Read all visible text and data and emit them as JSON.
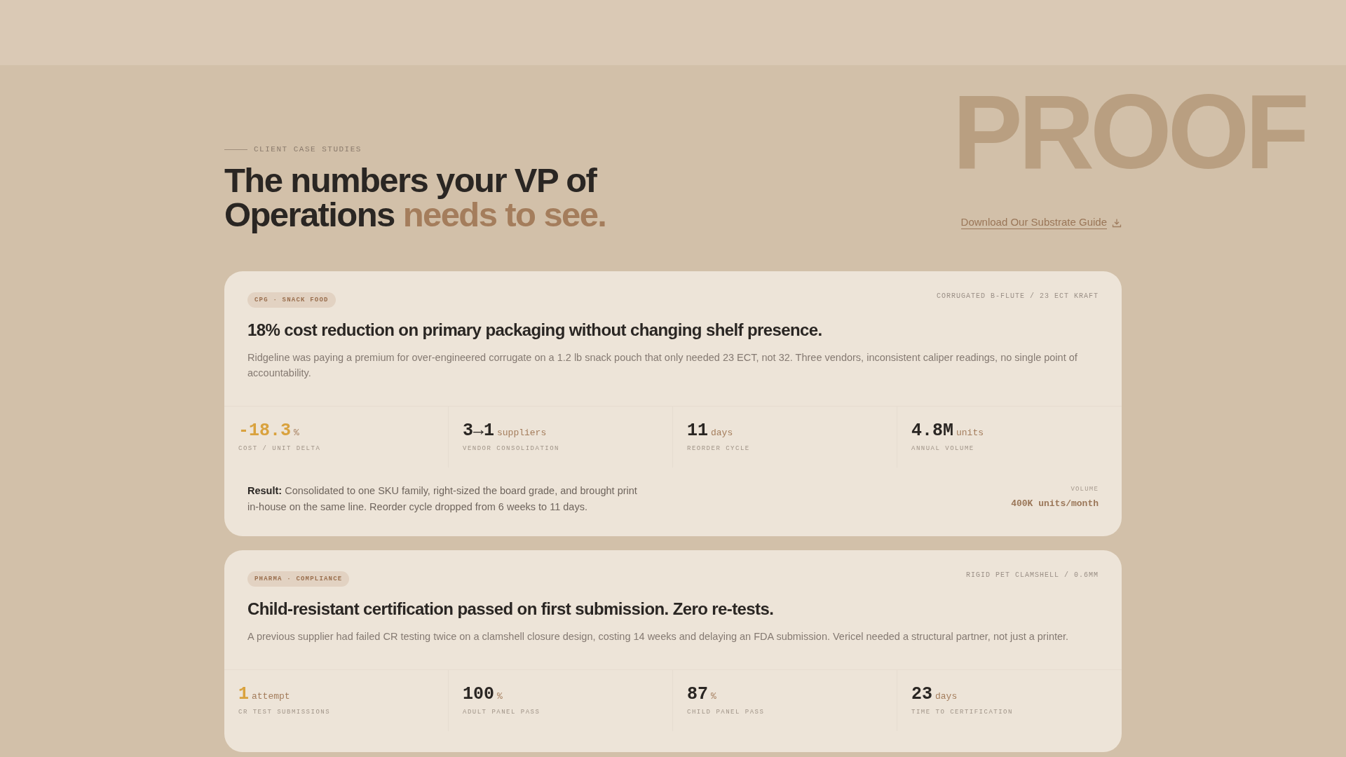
{
  "background_word": "PROOF",
  "header": {
    "eyebrow": "CLIENT CASE STUDIES",
    "headline": "The numbers your VP of Operations",
    "headline_accent": "needs to see.",
    "download_link": "Download Our Substrate Guide"
  },
  "cases": [
    {
      "tag": "CPG · SNACK FOOD",
      "material": "CORRUGATED B-FLUTE / 23 ECT KRAFT",
      "title": "18% cost reduction on primary packaging without changing shelf presence.",
      "description": "Ridgeline was paying a premium for over-engineered corrugate on a 1.2 lb snack pouch that only needed 23 ECT, not 32. Three vendors, inconsistent caliper readings, no single point of accountability.",
      "stats": [
        {
          "value": "-18.3",
          "unit": "%",
          "label": "COST / UNIT DELTA",
          "accent": true
        },
        {
          "value": "3→1",
          "unit": "suppliers",
          "label": "VENDOR CONSOLIDATION",
          "accent": false
        },
        {
          "value": "11",
          "unit": "days",
          "label": "REORDER CYCLE",
          "accent": false
        },
        {
          "value": "4.8M",
          "unit": "units",
          "label": "ANNUAL VOLUME",
          "accent": false
        }
      ],
      "result": "**Result:** Consolidated to one SKU family, right-sized the board grade, and brought print in-house on the same line. Reorder cycle dropped from 6 weeks to 11 days.",
      "side_label": "VOLUME",
      "side_value": "400K units/month"
    },
    {
      "tag": "PHARMA · COMPLIANCE",
      "material": "RIGID PET CLAMSHELL / 0.6MM",
      "title": "Child-resistant certification passed on first submission. Zero re-tests.",
      "description": "A previous supplier had failed CR testing twice on a clamshell closure design, costing 14 weeks and delaying an FDA submission. Vericel needed a structural partner, not just a printer.",
      "stats": [
        {
          "value": "1",
          "unit": "attempt",
          "label": "CR TEST SUBMISSIONS",
          "accent": true
        },
        {
          "value": "100",
          "unit": "%",
          "label": "ADULT PANEL PASS",
          "accent": false
        },
        {
          "value": "87",
          "unit": "%",
          "label": "CHILD PANEL PASS",
          "accent": false
        },
        {
          "value": "23",
          "unit": "days",
          "label": "TIME TO CERTIFICATION",
          "accent": false
        }
      ]
    }
  ]
}
